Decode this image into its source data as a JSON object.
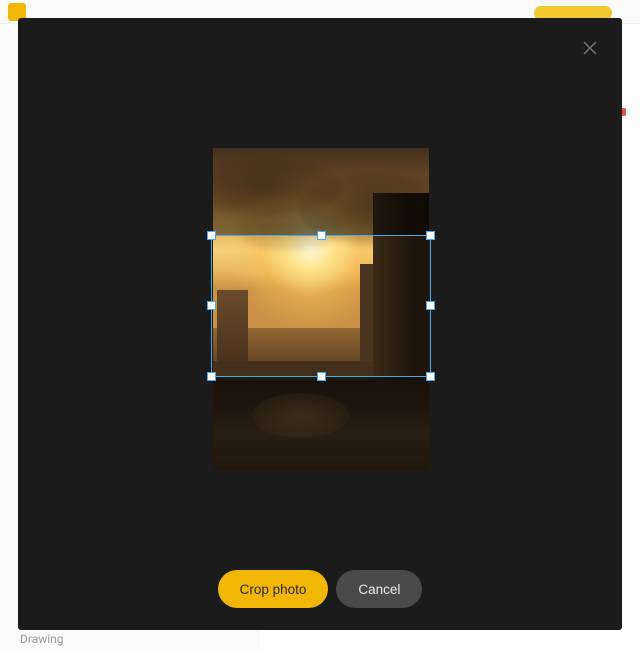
{
  "modal": {
    "buttons": {
      "primary": "Crop photo",
      "secondary": "Cancel"
    },
    "close_label": "Close",
    "crop": {
      "top_pct": 27,
      "height_pct": 44
    }
  },
  "background": {
    "sidebar_bottom_item": "Drawing"
  },
  "colors": {
    "accent": "#f2b705",
    "modal_bg": "#1b1b1b",
    "crop_border": "#4aa8e8"
  }
}
